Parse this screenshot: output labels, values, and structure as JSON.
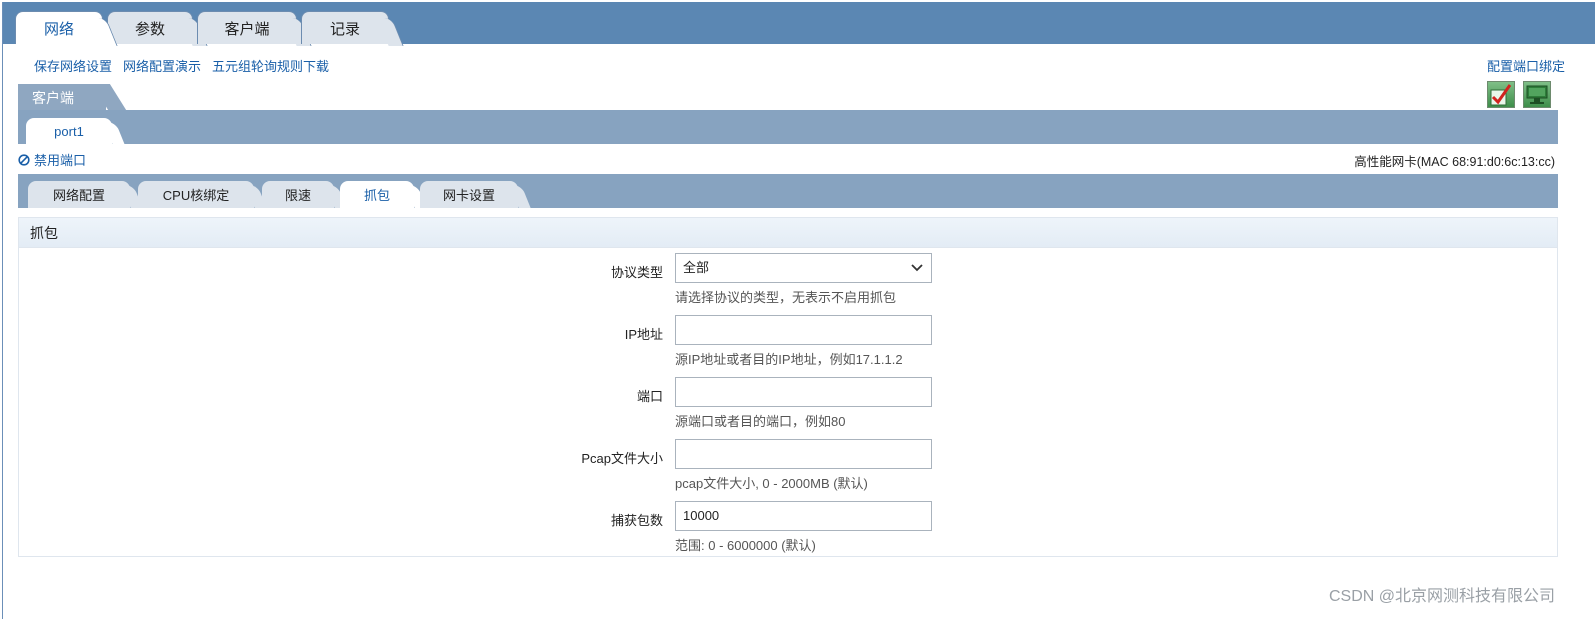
{
  "top_tabs": [
    {
      "label": "网络",
      "active": true
    },
    {
      "label": "参数",
      "active": false
    },
    {
      "label": "客户端",
      "active": false
    },
    {
      "label": "记录",
      "active": false
    }
  ],
  "links": {
    "save": "保存网络设置",
    "demo": "网络配置演示",
    "download": "五元组轮询规则下载",
    "bind_port": "配置端口绑定"
  },
  "client": {
    "tab_label": "客户端",
    "port_tab": "port1"
  },
  "actions": {
    "apply_icon": "check-icon",
    "network_icon": "network-monitor-icon"
  },
  "disable_port": "禁用端口",
  "nic_info": "高性能网卡(MAC 68:91:d0:6c:13:cc)",
  "sub_tabs": [
    {
      "label": "网络配置",
      "active": false
    },
    {
      "label": "CPU核绑定",
      "active": false
    },
    {
      "label": "限速",
      "active": false
    },
    {
      "label": "抓包",
      "active": true
    },
    {
      "label": "网卡设置",
      "active": false
    }
  ],
  "panel": {
    "title": "抓包",
    "fields": {
      "protocol": {
        "label": "协议类型",
        "value": "全部",
        "help": "请选择协议的类型，无表示不启用抓包"
      },
      "ip": {
        "label": "IP地址",
        "value": "",
        "help": "源IP地址或者目的IP地址，例如17.1.1.2"
      },
      "port": {
        "label": "端口",
        "value": "",
        "help": "源端口或者目的端口，例如80"
      },
      "pcap_size": {
        "label": "Pcap文件大小",
        "value": "",
        "help": "pcap文件大小, 0 - 2000MB (默认)"
      },
      "capture_count": {
        "label": "捕获包数",
        "value": "10000",
        "help": "范围: 0 - 6000000 (默认)"
      }
    }
  },
  "watermark": "CSDN @北京网测科技有限公司"
}
